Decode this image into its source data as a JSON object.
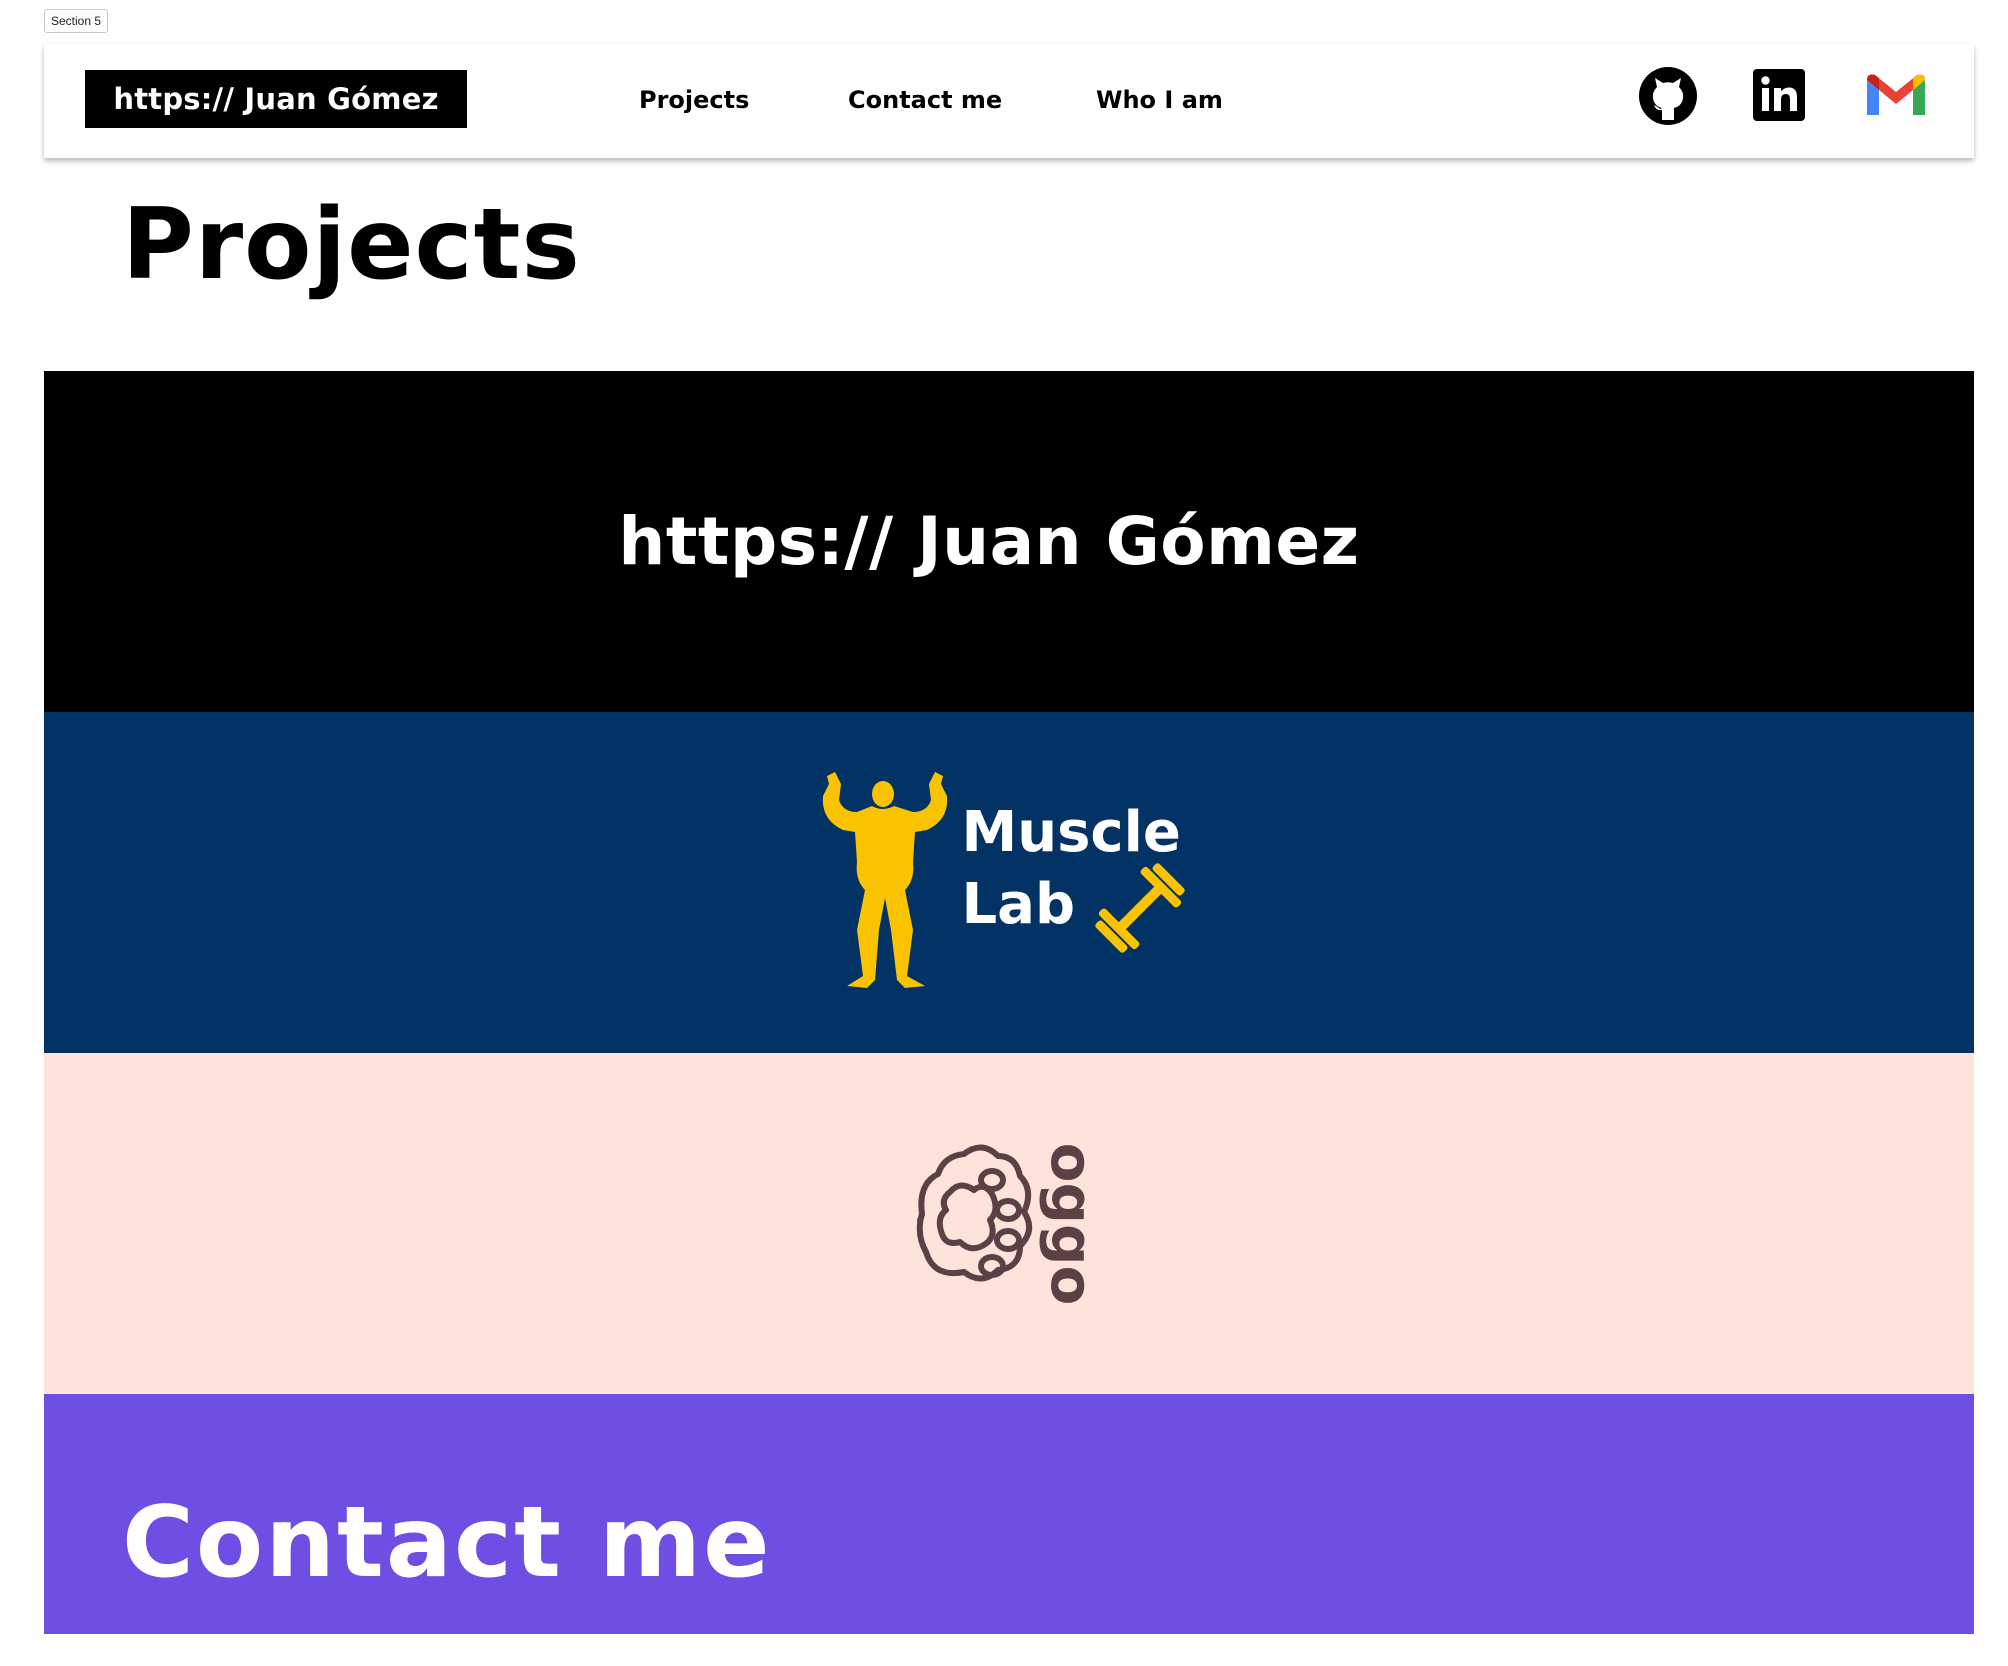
{
  "frame_label": "Section 5",
  "header": {
    "brand": "https:// Juan Gómez",
    "nav": {
      "projects": "Projects",
      "contact": "Contact me",
      "who": "Who I am"
    },
    "social_icons": [
      "github-icon",
      "linkedin-icon",
      "gmail-icon"
    ]
  },
  "main": {
    "title": "Projects",
    "projects": [
      {
        "name": "https:// Juan Gómez",
        "background": "#000000",
        "text_color": "#ffffff"
      },
      {
        "name_line1": "Muscle",
        "name_line2": "Lab",
        "background": "#023364",
        "accent": "#f9c301",
        "text_color": "#ffffff",
        "icons": [
          "bodybuilder-icon",
          "dumbbell-icon"
        ]
      },
      {
        "name": "oggo",
        "background": "#fde3d9",
        "accent": "#5a4145",
        "icons": [
          "paw-icon"
        ]
      }
    ]
  },
  "contact": {
    "title": "Contact me",
    "background": "#6f4ee4"
  }
}
